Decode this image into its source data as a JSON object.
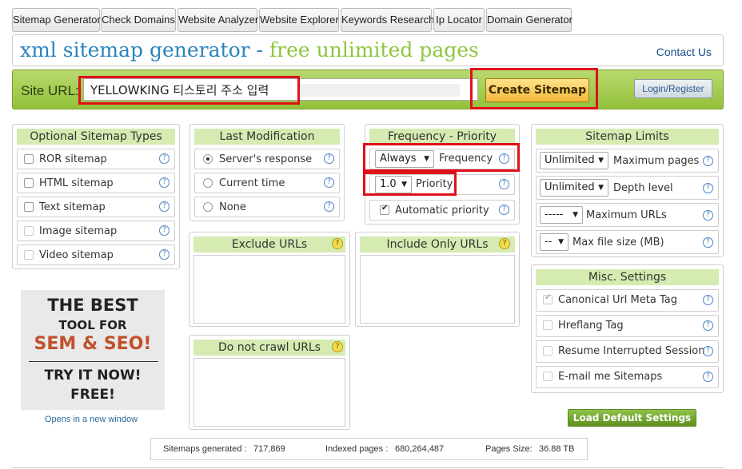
{
  "nav": {
    "tabs": [
      "Sitemap Generator",
      "Check Domains",
      "Website Analyzer",
      "Website Explorer",
      "Keywords Research",
      "Ip Locator",
      "Domain Generator"
    ]
  },
  "header": {
    "title_main": "xml sitemap generator",
    "title_sep": " - ",
    "title_accent": "free unlimited pages",
    "contact": "Contact Us"
  },
  "url_bar": {
    "label": "Site URL:",
    "value": "YELLOWKING 티스토리 주소 입력",
    "create_button": "Create Sitemap",
    "login_button": "Login/Register"
  },
  "optional_types": {
    "title": "Optional Sitemap Types",
    "items": [
      {
        "label": "ROR sitemap",
        "checked": false,
        "disabled": false
      },
      {
        "label": "HTML sitemap",
        "checked": false,
        "disabled": false
      },
      {
        "label": "Text sitemap",
        "checked": false,
        "disabled": false
      },
      {
        "label": "Image sitemap",
        "checked": false,
        "disabled": true
      },
      {
        "label": "Video sitemap",
        "checked": false,
        "disabled": true
      }
    ]
  },
  "last_modification": {
    "title": "Last Modification",
    "options": [
      {
        "label": "Server's response",
        "selected": true
      },
      {
        "label": "Current time",
        "selected": false
      },
      {
        "label": "None",
        "selected": false
      }
    ]
  },
  "frequency_priority": {
    "title": "Frequency - Priority",
    "frequency_value": "Always",
    "frequency_label": "Frequency",
    "priority_value": "1.0",
    "priority_label": "Priority",
    "auto_priority_label": "Automatic priority",
    "auto_priority_checked": true
  },
  "sitemap_limits": {
    "title": "Sitemap Limits",
    "rows": [
      {
        "value": "Unlimited",
        "label": "Maximum pages"
      },
      {
        "value": "Unlimited",
        "label": "Depth level"
      },
      {
        "value": "-----",
        "label": "Maximum URLs"
      },
      {
        "value": "--",
        "label": "Max file size (MB)"
      }
    ]
  },
  "exclude_urls": {
    "title": "Exclude URLs"
  },
  "include_urls": {
    "title": "Include Only URLs"
  },
  "no_crawl_urls": {
    "title": "Do not crawl URLs"
  },
  "misc": {
    "title": "Misc. Settings",
    "items": [
      {
        "label": "Canonical Url Meta Tag",
        "checked": true,
        "disabled": true
      },
      {
        "label": "Hreflang Tag",
        "checked": false,
        "disabled": true
      },
      {
        "label": "Resume Interrupted Session",
        "checked": false,
        "disabled": true
      },
      {
        "label": "E-mail me Sitemaps",
        "checked": false,
        "disabled": true
      }
    ]
  },
  "ad": {
    "line1": "THE BEST",
    "line2": "TOOL FOR",
    "line3": "SEM & SEO!",
    "line4": "TRY IT NOW!",
    "line5": "FREE!",
    "opens": "Opens in a new window"
  },
  "load_default": "Load Default Settings",
  "stats": {
    "generated_label": "Sitemaps generated :",
    "generated_value": "717,869",
    "indexed_label": "Indexed pages :",
    "indexed_value": "680,264,487",
    "size_label": "Pages Size:",
    "size_value": "36.88 TB"
  },
  "help_glyph": "?",
  "caret_glyph": "▼",
  "colors": {
    "title_blue": "#2a83bf",
    "title_green": "#8dc63f",
    "panel_header": "#d5ebb1",
    "highlight_red": "#e0101a",
    "create_button": "#f2b93b"
  }
}
